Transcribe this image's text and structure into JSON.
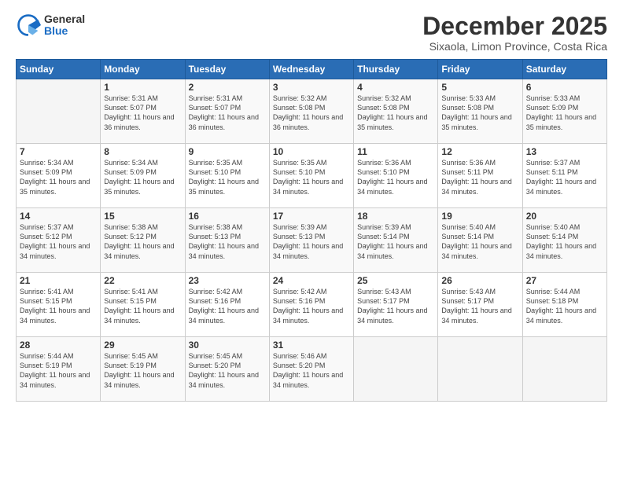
{
  "logo": {
    "general": "General",
    "blue": "Blue"
  },
  "title": "December 2025",
  "location": "Sixaola, Limon Province, Costa Rica",
  "days_of_week": [
    "Sunday",
    "Monday",
    "Tuesday",
    "Wednesday",
    "Thursday",
    "Friday",
    "Saturday"
  ],
  "weeks": [
    [
      {
        "day": "",
        "sunrise": "",
        "sunset": "",
        "daylight": ""
      },
      {
        "day": "1",
        "sunrise": "Sunrise: 5:31 AM",
        "sunset": "Sunset: 5:07 PM",
        "daylight": "Daylight: 11 hours and 36 minutes."
      },
      {
        "day": "2",
        "sunrise": "Sunrise: 5:31 AM",
        "sunset": "Sunset: 5:07 PM",
        "daylight": "Daylight: 11 hours and 36 minutes."
      },
      {
        "day": "3",
        "sunrise": "Sunrise: 5:32 AM",
        "sunset": "Sunset: 5:08 PM",
        "daylight": "Daylight: 11 hours and 36 minutes."
      },
      {
        "day": "4",
        "sunrise": "Sunrise: 5:32 AM",
        "sunset": "Sunset: 5:08 PM",
        "daylight": "Daylight: 11 hours and 35 minutes."
      },
      {
        "day": "5",
        "sunrise": "Sunrise: 5:33 AM",
        "sunset": "Sunset: 5:08 PM",
        "daylight": "Daylight: 11 hours and 35 minutes."
      },
      {
        "day": "6",
        "sunrise": "Sunrise: 5:33 AM",
        "sunset": "Sunset: 5:09 PM",
        "daylight": "Daylight: 11 hours and 35 minutes."
      }
    ],
    [
      {
        "day": "7",
        "sunrise": "Sunrise: 5:34 AM",
        "sunset": "Sunset: 5:09 PM",
        "daylight": "Daylight: 11 hours and 35 minutes."
      },
      {
        "day": "8",
        "sunrise": "Sunrise: 5:34 AM",
        "sunset": "Sunset: 5:09 PM",
        "daylight": "Daylight: 11 hours and 35 minutes."
      },
      {
        "day": "9",
        "sunrise": "Sunrise: 5:35 AM",
        "sunset": "Sunset: 5:10 PM",
        "daylight": "Daylight: 11 hours and 35 minutes."
      },
      {
        "day": "10",
        "sunrise": "Sunrise: 5:35 AM",
        "sunset": "Sunset: 5:10 PM",
        "daylight": "Daylight: 11 hours and 34 minutes."
      },
      {
        "day": "11",
        "sunrise": "Sunrise: 5:36 AM",
        "sunset": "Sunset: 5:10 PM",
        "daylight": "Daylight: 11 hours and 34 minutes."
      },
      {
        "day": "12",
        "sunrise": "Sunrise: 5:36 AM",
        "sunset": "Sunset: 5:11 PM",
        "daylight": "Daylight: 11 hours and 34 minutes."
      },
      {
        "day": "13",
        "sunrise": "Sunrise: 5:37 AM",
        "sunset": "Sunset: 5:11 PM",
        "daylight": "Daylight: 11 hours and 34 minutes."
      }
    ],
    [
      {
        "day": "14",
        "sunrise": "Sunrise: 5:37 AM",
        "sunset": "Sunset: 5:12 PM",
        "daylight": "Daylight: 11 hours and 34 minutes."
      },
      {
        "day": "15",
        "sunrise": "Sunrise: 5:38 AM",
        "sunset": "Sunset: 5:12 PM",
        "daylight": "Daylight: 11 hours and 34 minutes."
      },
      {
        "day": "16",
        "sunrise": "Sunrise: 5:38 AM",
        "sunset": "Sunset: 5:13 PM",
        "daylight": "Daylight: 11 hours and 34 minutes."
      },
      {
        "day": "17",
        "sunrise": "Sunrise: 5:39 AM",
        "sunset": "Sunset: 5:13 PM",
        "daylight": "Daylight: 11 hours and 34 minutes."
      },
      {
        "day": "18",
        "sunrise": "Sunrise: 5:39 AM",
        "sunset": "Sunset: 5:14 PM",
        "daylight": "Daylight: 11 hours and 34 minutes."
      },
      {
        "day": "19",
        "sunrise": "Sunrise: 5:40 AM",
        "sunset": "Sunset: 5:14 PM",
        "daylight": "Daylight: 11 hours and 34 minutes."
      },
      {
        "day": "20",
        "sunrise": "Sunrise: 5:40 AM",
        "sunset": "Sunset: 5:14 PM",
        "daylight": "Daylight: 11 hours and 34 minutes."
      }
    ],
    [
      {
        "day": "21",
        "sunrise": "Sunrise: 5:41 AM",
        "sunset": "Sunset: 5:15 PM",
        "daylight": "Daylight: 11 hours and 34 minutes."
      },
      {
        "day": "22",
        "sunrise": "Sunrise: 5:41 AM",
        "sunset": "Sunset: 5:15 PM",
        "daylight": "Daylight: 11 hours and 34 minutes."
      },
      {
        "day": "23",
        "sunrise": "Sunrise: 5:42 AM",
        "sunset": "Sunset: 5:16 PM",
        "daylight": "Daylight: 11 hours and 34 minutes."
      },
      {
        "day": "24",
        "sunrise": "Sunrise: 5:42 AM",
        "sunset": "Sunset: 5:16 PM",
        "daylight": "Daylight: 11 hours and 34 minutes."
      },
      {
        "day": "25",
        "sunrise": "Sunrise: 5:43 AM",
        "sunset": "Sunset: 5:17 PM",
        "daylight": "Daylight: 11 hours and 34 minutes."
      },
      {
        "day": "26",
        "sunrise": "Sunrise: 5:43 AM",
        "sunset": "Sunset: 5:17 PM",
        "daylight": "Daylight: 11 hours and 34 minutes."
      },
      {
        "day": "27",
        "sunrise": "Sunrise: 5:44 AM",
        "sunset": "Sunset: 5:18 PM",
        "daylight": "Daylight: 11 hours and 34 minutes."
      }
    ],
    [
      {
        "day": "28",
        "sunrise": "Sunrise: 5:44 AM",
        "sunset": "Sunset: 5:19 PM",
        "daylight": "Daylight: 11 hours and 34 minutes."
      },
      {
        "day": "29",
        "sunrise": "Sunrise: 5:45 AM",
        "sunset": "Sunset: 5:19 PM",
        "daylight": "Daylight: 11 hours and 34 minutes."
      },
      {
        "day": "30",
        "sunrise": "Sunrise: 5:45 AM",
        "sunset": "Sunset: 5:20 PM",
        "daylight": "Daylight: 11 hours and 34 minutes."
      },
      {
        "day": "31",
        "sunrise": "Sunrise: 5:46 AM",
        "sunset": "Sunset: 5:20 PM",
        "daylight": "Daylight: 11 hours and 34 minutes."
      },
      {
        "day": "",
        "sunrise": "",
        "sunset": "",
        "daylight": ""
      },
      {
        "day": "",
        "sunrise": "",
        "sunset": "",
        "daylight": ""
      },
      {
        "day": "",
        "sunrise": "",
        "sunset": "",
        "daylight": ""
      }
    ]
  ]
}
